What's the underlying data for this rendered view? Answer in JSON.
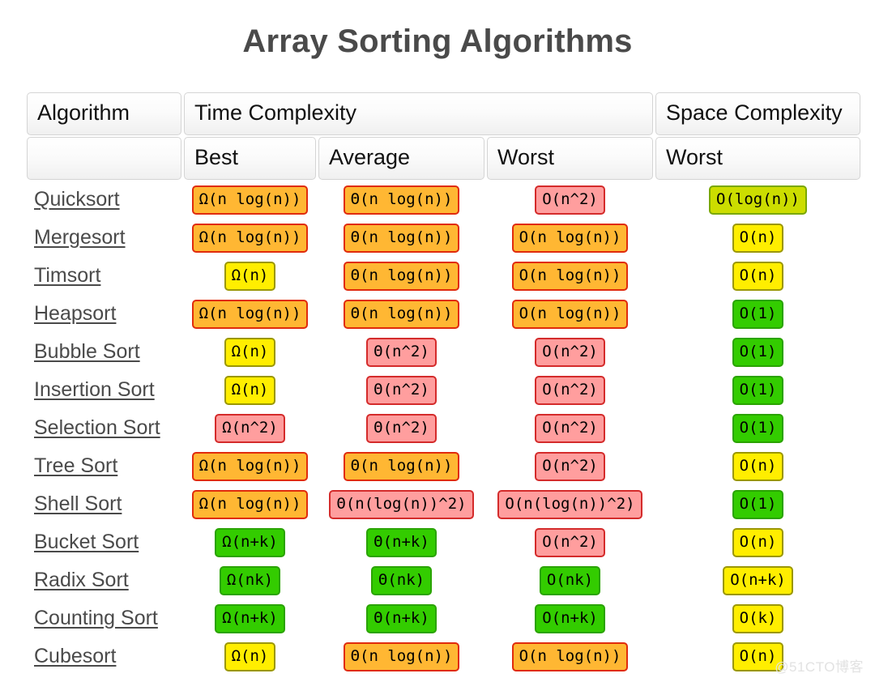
{
  "title": "Array Sorting Algorithms",
  "watermark": "@51CTO博客",
  "headers": {
    "algorithm": "Algorithm",
    "time_complexity": "Time Complexity",
    "space_complexity": "Space Complexity",
    "blank": "",
    "best": "Best",
    "average": "Average",
    "worst_time": "Worst",
    "worst_space": "Worst"
  },
  "colors": {
    "green": "#33cc00",
    "lime": "#ccdd00",
    "yellow": "#ffee00",
    "orange": "#ffb733",
    "red": "#ff9e9e",
    "title_text": "#4a4a4a",
    "link_text": "#4a4a4a",
    "header_border": "#d4d4d4",
    "watermark": "#e2e2e2"
  },
  "rows": [
    {
      "name": "Quicksort",
      "best": {
        "text": "Ω(n log(n))",
        "color": "orange"
      },
      "average": {
        "text": "Θ(n log(n))",
        "color": "orange"
      },
      "worst": {
        "text": "O(n^2)",
        "color": "red"
      },
      "space": {
        "text": "O(log(n))",
        "color": "lime"
      }
    },
    {
      "name": "Mergesort",
      "best": {
        "text": "Ω(n log(n))",
        "color": "orange"
      },
      "average": {
        "text": "Θ(n log(n))",
        "color": "orange"
      },
      "worst": {
        "text": "O(n log(n))",
        "color": "orange"
      },
      "space": {
        "text": "O(n)",
        "color": "yellow"
      }
    },
    {
      "name": "Timsort",
      "best": {
        "text": "Ω(n)",
        "color": "yellow"
      },
      "average": {
        "text": "Θ(n log(n))",
        "color": "orange"
      },
      "worst": {
        "text": "O(n log(n))",
        "color": "orange"
      },
      "space": {
        "text": "O(n)",
        "color": "yellow"
      }
    },
    {
      "name": "Heapsort",
      "best": {
        "text": "Ω(n log(n))",
        "color": "orange"
      },
      "average": {
        "text": "Θ(n log(n))",
        "color": "orange"
      },
      "worst": {
        "text": "O(n log(n))",
        "color": "orange"
      },
      "space": {
        "text": "O(1)",
        "color": "green"
      }
    },
    {
      "name": "Bubble Sort",
      "best": {
        "text": "Ω(n)",
        "color": "yellow"
      },
      "average": {
        "text": "Θ(n^2)",
        "color": "red"
      },
      "worst": {
        "text": "O(n^2)",
        "color": "red"
      },
      "space": {
        "text": "O(1)",
        "color": "green"
      }
    },
    {
      "name": "Insertion Sort",
      "best": {
        "text": "Ω(n)",
        "color": "yellow"
      },
      "average": {
        "text": "Θ(n^2)",
        "color": "red"
      },
      "worst": {
        "text": "O(n^2)",
        "color": "red"
      },
      "space": {
        "text": "O(1)",
        "color": "green"
      }
    },
    {
      "name": "Selection Sort",
      "best": {
        "text": "Ω(n^2)",
        "color": "red"
      },
      "average": {
        "text": "Θ(n^2)",
        "color": "red"
      },
      "worst": {
        "text": "O(n^2)",
        "color": "red"
      },
      "space": {
        "text": "O(1)",
        "color": "green"
      }
    },
    {
      "name": "Tree Sort",
      "best": {
        "text": "Ω(n log(n))",
        "color": "orange"
      },
      "average": {
        "text": "Θ(n log(n))",
        "color": "orange"
      },
      "worst": {
        "text": "O(n^2)",
        "color": "red"
      },
      "space": {
        "text": "O(n)",
        "color": "yellow"
      }
    },
    {
      "name": "Shell Sort",
      "best": {
        "text": "Ω(n log(n))",
        "color": "orange"
      },
      "average": {
        "text": "Θ(n(log(n))^2)",
        "color": "red"
      },
      "worst": {
        "text": "O(n(log(n))^2)",
        "color": "red"
      },
      "space": {
        "text": "O(1)",
        "color": "green"
      }
    },
    {
      "name": "Bucket Sort",
      "best": {
        "text": "Ω(n+k)",
        "color": "green"
      },
      "average": {
        "text": "Θ(n+k)",
        "color": "green"
      },
      "worst": {
        "text": "O(n^2)",
        "color": "red"
      },
      "space": {
        "text": "O(n)",
        "color": "yellow"
      }
    },
    {
      "name": "Radix Sort",
      "best": {
        "text": "Ω(nk)",
        "color": "green"
      },
      "average": {
        "text": "Θ(nk)",
        "color": "green"
      },
      "worst": {
        "text": "O(nk)",
        "color": "green"
      },
      "space": {
        "text": "O(n+k)",
        "color": "yellow"
      }
    },
    {
      "name": "Counting Sort",
      "best": {
        "text": "Ω(n+k)",
        "color": "green"
      },
      "average": {
        "text": "Θ(n+k)",
        "color": "green"
      },
      "worst": {
        "text": "O(n+k)",
        "color": "green"
      },
      "space": {
        "text": "O(k)",
        "color": "yellow"
      }
    },
    {
      "name": "Cubesort",
      "best": {
        "text": "Ω(n)",
        "color": "yellow"
      },
      "average": {
        "text": "Θ(n log(n))",
        "color": "orange"
      },
      "worst": {
        "text": "O(n log(n))",
        "color": "orange"
      },
      "space": {
        "text": "O(n)",
        "color": "yellow"
      }
    }
  ]
}
